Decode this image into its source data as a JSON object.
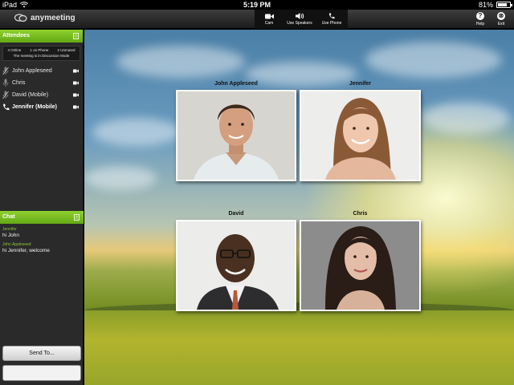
{
  "statusbar": {
    "device": "iPad",
    "time": "5:19 PM",
    "battery": "81%",
    "battery_level": 0.81
  },
  "app": {
    "logo_text": "anymeeting"
  },
  "toolbar": {
    "cam_label": "Cam",
    "speakers_label": "Use Speakers",
    "phone_label": "Use Phone",
    "help_label": "Help",
    "exit_label": "Exit"
  },
  "attendees": {
    "title": "Attendees",
    "online": "4 Online",
    "on_phone": "1 on Phone",
    "unmuted": "2 Unmuted",
    "mode": "The meeting is in Discussion Mode",
    "list": [
      {
        "name": "John Appleseed",
        "icon": "mic-muted-icon"
      },
      {
        "name": "Chris",
        "icon": "mic-icon"
      },
      {
        "name": "David (Mobile)",
        "icon": "mic-muted-icon"
      },
      {
        "name": "Jennifer (Mobile)",
        "icon": "phone-icon"
      }
    ]
  },
  "chat": {
    "title": "Chat",
    "messages": [
      {
        "from": "Jennifer",
        "text": "hi John"
      },
      {
        "from": "John Appleseed",
        "text": "hi Jennifer, welcome"
      }
    ],
    "send_label": "Send To...",
    "input_value": ""
  },
  "videos": [
    {
      "name": "John Appleseed"
    },
    {
      "name": "Jennifer"
    },
    {
      "name": "David"
    },
    {
      "name": "Chris"
    }
  ]
}
